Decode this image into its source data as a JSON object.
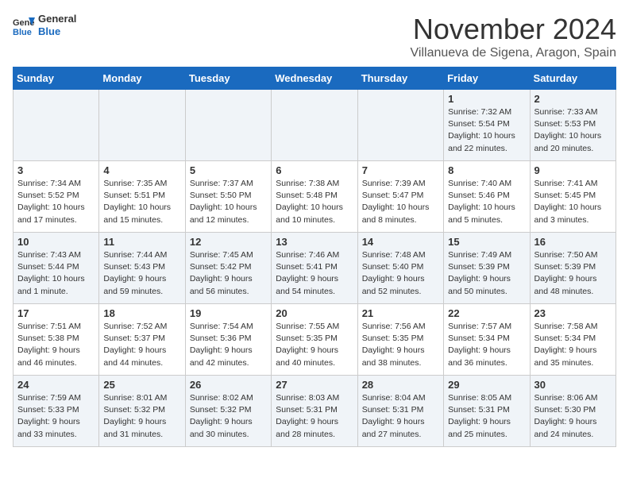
{
  "header": {
    "logo_general": "General",
    "logo_blue": "Blue",
    "month_title": "November 2024",
    "location": "Villanueva de Sigena, Aragon, Spain"
  },
  "days_of_week": [
    "Sunday",
    "Monday",
    "Tuesday",
    "Wednesday",
    "Thursday",
    "Friday",
    "Saturday"
  ],
  "weeks": [
    [
      {
        "day": "",
        "info": ""
      },
      {
        "day": "",
        "info": ""
      },
      {
        "day": "",
        "info": ""
      },
      {
        "day": "",
        "info": ""
      },
      {
        "day": "",
        "info": ""
      },
      {
        "day": "1",
        "info": "Sunrise: 7:32 AM\nSunset: 5:54 PM\nDaylight: 10 hours and 22 minutes."
      },
      {
        "day": "2",
        "info": "Sunrise: 7:33 AM\nSunset: 5:53 PM\nDaylight: 10 hours and 20 minutes."
      }
    ],
    [
      {
        "day": "3",
        "info": "Sunrise: 7:34 AM\nSunset: 5:52 PM\nDaylight: 10 hours and 17 minutes."
      },
      {
        "day": "4",
        "info": "Sunrise: 7:35 AM\nSunset: 5:51 PM\nDaylight: 10 hours and 15 minutes."
      },
      {
        "day": "5",
        "info": "Sunrise: 7:37 AM\nSunset: 5:50 PM\nDaylight: 10 hours and 12 minutes."
      },
      {
        "day": "6",
        "info": "Sunrise: 7:38 AM\nSunset: 5:48 PM\nDaylight: 10 hours and 10 minutes."
      },
      {
        "day": "7",
        "info": "Sunrise: 7:39 AM\nSunset: 5:47 PM\nDaylight: 10 hours and 8 minutes."
      },
      {
        "day": "8",
        "info": "Sunrise: 7:40 AM\nSunset: 5:46 PM\nDaylight: 10 hours and 5 minutes."
      },
      {
        "day": "9",
        "info": "Sunrise: 7:41 AM\nSunset: 5:45 PM\nDaylight: 10 hours and 3 minutes."
      }
    ],
    [
      {
        "day": "10",
        "info": "Sunrise: 7:43 AM\nSunset: 5:44 PM\nDaylight: 10 hours and 1 minute."
      },
      {
        "day": "11",
        "info": "Sunrise: 7:44 AM\nSunset: 5:43 PM\nDaylight: 9 hours and 59 minutes."
      },
      {
        "day": "12",
        "info": "Sunrise: 7:45 AM\nSunset: 5:42 PM\nDaylight: 9 hours and 56 minutes."
      },
      {
        "day": "13",
        "info": "Sunrise: 7:46 AM\nSunset: 5:41 PM\nDaylight: 9 hours and 54 minutes."
      },
      {
        "day": "14",
        "info": "Sunrise: 7:48 AM\nSunset: 5:40 PM\nDaylight: 9 hours and 52 minutes."
      },
      {
        "day": "15",
        "info": "Sunrise: 7:49 AM\nSunset: 5:39 PM\nDaylight: 9 hours and 50 minutes."
      },
      {
        "day": "16",
        "info": "Sunrise: 7:50 AM\nSunset: 5:39 PM\nDaylight: 9 hours and 48 minutes."
      }
    ],
    [
      {
        "day": "17",
        "info": "Sunrise: 7:51 AM\nSunset: 5:38 PM\nDaylight: 9 hours and 46 minutes."
      },
      {
        "day": "18",
        "info": "Sunrise: 7:52 AM\nSunset: 5:37 PM\nDaylight: 9 hours and 44 minutes."
      },
      {
        "day": "19",
        "info": "Sunrise: 7:54 AM\nSunset: 5:36 PM\nDaylight: 9 hours and 42 minutes."
      },
      {
        "day": "20",
        "info": "Sunrise: 7:55 AM\nSunset: 5:35 PM\nDaylight: 9 hours and 40 minutes."
      },
      {
        "day": "21",
        "info": "Sunrise: 7:56 AM\nSunset: 5:35 PM\nDaylight: 9 hours and 38 minutes."
      },
      {
        "day": "22",
        "info": "Sunrise: 7:57 AM\nSunset: 5:34 PM\nDaylight: 9 hours and 36 minutes."
      },
      {
        "day": "23",
        "info": "Sunrise: 7:58 AM\nSunset: 5:34 PM\nDaylight: 9 hours and 35 minutes."
      }
    ],
    [
      {
        "day": "24",
        "info": "Sunrise: 7:59 AM\nSunset: 5:33 PM\nDaylight: 9 hours and 33 minutes."
      },
      {
        "day": "25",
        "info": "Sunrise: 8:01 AM\nSunset: 5:32 PM\nDaylight: 9 hours and 31 minutes."
      },
      {
        "day": "26",
        "info": "Sunrise: 8:02 AM\nSunset: 5:32 PM\nDaylight: 9 hours and 30 minutes."
      },
      {
        "day": "27",
        "info": "Sunrise: 8:03 AM\nSunset: 5:31 PM\nDaylight: 9 hours and 28 minutes."
      },
      {
        "day": "28",
        "info": "Sunrise: 8:04 AM\nSunset: 5:31 PM\nDaylight: 9 hours and 27 minutes."
      },
      {
        "day": "29",
        "info": "Sunrise: 8:05 AM\nSunset: 5:31 PM\nDaylight: 9 hours and 25 minutes."
      },
      {
        "day": "30",
        "info": "Sunrise: 8:06 AM\nSunset: 5:30 PM\nDaylight: 9 hours and 24 minutes."
      }
    ]
  ]
}
